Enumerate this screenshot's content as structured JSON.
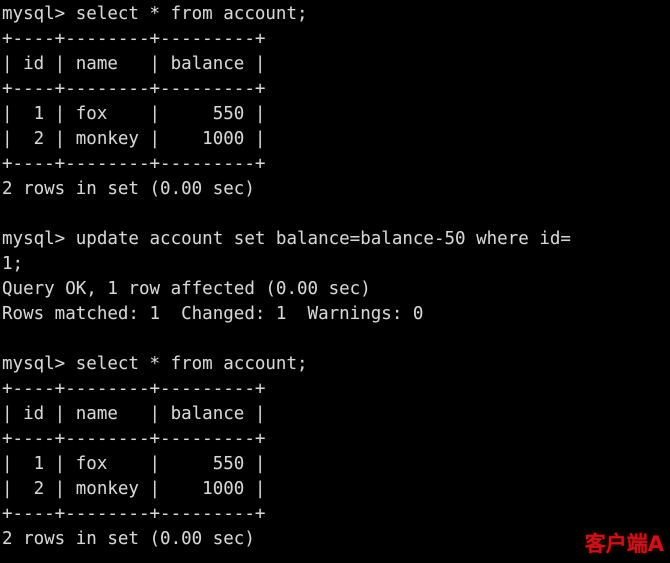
{
  "terminal": {
    "background_color": "#000000",
    "text_color": "#d6d6d6",
    "prompt": "mysql>",
    "lines": [
      "mysql> select * from account;",
      "+----+--------+---------+",
      "| id | name   | balance |",
      "+----+--------+---------+",
      "|  1 | fox    |     550 |",
      "|  2 | monkey |    1000 |",
      "+----+--------+---------+",
      "2 rows in set (0.00 sec)",
      "",
      "mysql> update account set balance=balance-50 where id=",
      "1;",
      "Query OK, 1 row affected (0.00 sec)",
      "Rows matched: 1  Changed: 1  Warnings: 0",
      "",
      "mysql> select * from account;",
      "+----+--------+---------+",
      "| id | name   | balance |",
      "+----+--------+---------+",
      "|  1 | fox    |     550 |",
      "|  2 | monkey |    1000 |",
      "+----+--------+---------+",
      "2 rows in set (0.00 sec)"
    ]
  },
  "statements": [
    {
      "sql": "select * from account;",
      "result_table": {
        "columns": [
          "id",
          "name",
          "balance"
        ],
        "rows": [
          [
            "1",
            "fox",
            "550"
          ],
          [
            "2",
            "monkey",
            "1000"
          ]
        ]
      },
      "status": "2 rows in set (0.00 sec)"
    },
    {
      "sql": "update account set balance=balance-50 where id=1;",
      "status": "Query OK, 1 row affected (0.00 sec)",
      "detail": "Rows matched: 1  Changed: 1  Warnings: 0"
    },
    {
      "sql": "select * from account;",
      "result_table": {
        "columns": [
          "id",
          "name",
          "balance"
        ],
        "rows": [
          [
            "1",
            "fox",
            "550"
          ],
          [
            "2",
            "monkey",
            "1000"
          ]
        ]
      },
      "status": "2 rows in set (0.00 sec)"
    }
  ],
  "annotation": {
    "text": "客户端A",
    "color": "#c3161c"
  }
}
